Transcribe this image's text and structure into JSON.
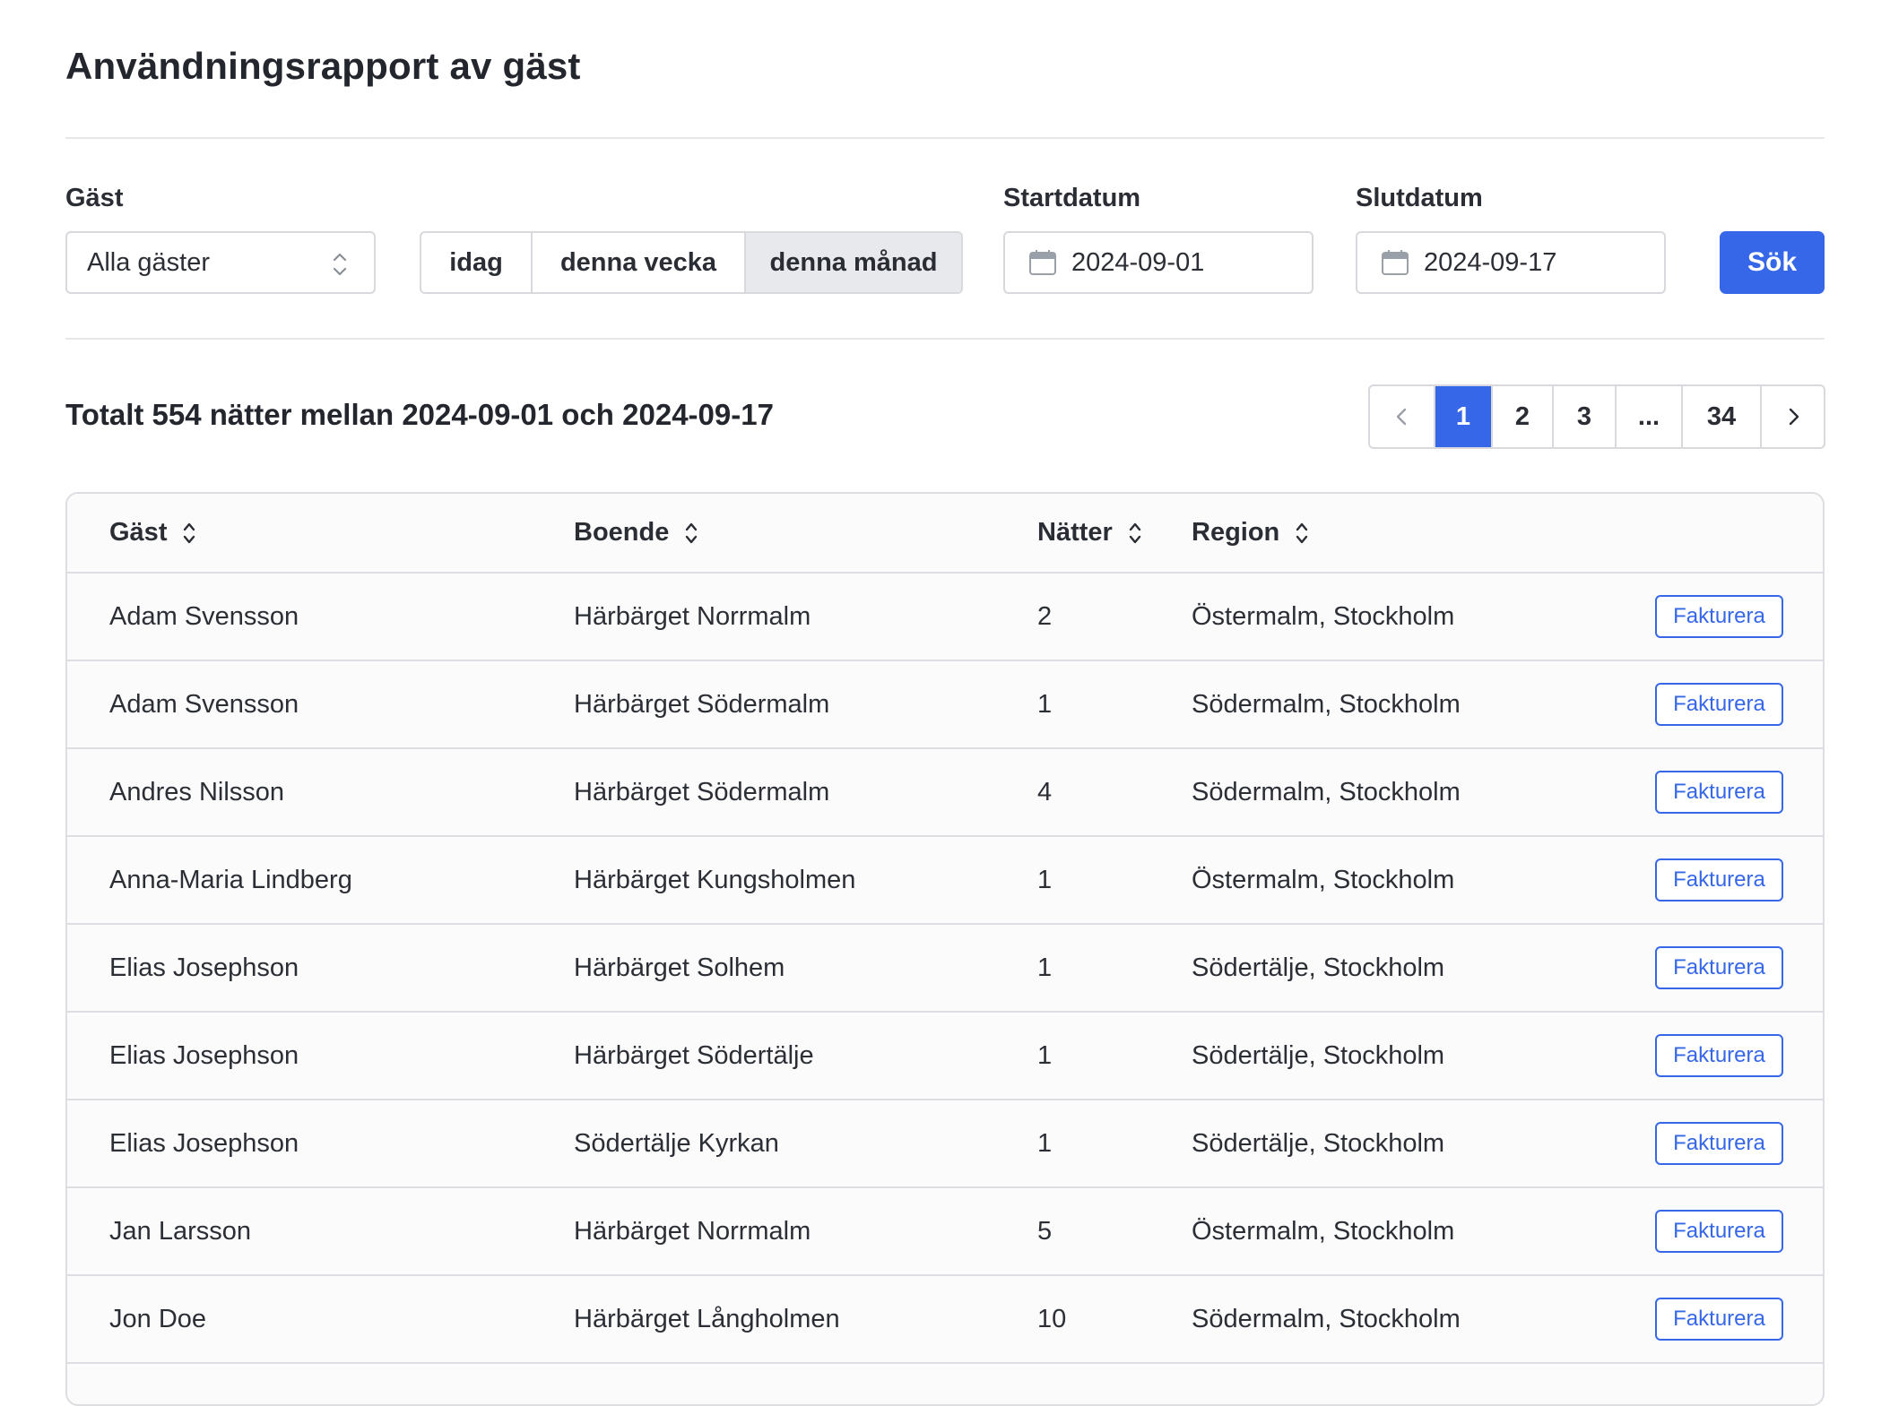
{
  "page": {
    "title": "Användningsrapport av gäst"
  },
  "filters": {
    "guest_label": "Gäst",
    "guest_value": "Alla gäster",
    "periods": [
      {
        "label": "idag",
        "active": false
      },
      {
        "label": "denna vecka",
        "active": false
      },
      {
        "label": "denna månad",
        "active": true
      }
    ],
    "start_label": "Startdatum",
    "start_value": "2024-09-01",
    "end_label": "Slutdatum",
    "end_value": "2024-09-17",
    "search_label": "Sök"
  },
  "summary": "Totalt 554 nätter mellan 2024-09-01 och 2024-09-17",
  "pagination": {
    "pages": [
      "1",
      "2",
      "3",
      "...",
      "34"
    ],
    "current": "1"
  },
  "table": {
    "columns": [
      "Gäst",
      "Boende",
      "Nätter",
      "Region"
    ],
    "action_label": "Fakturera",
    "rows": [
      {
        "guest": "Adam Svensson",
        "accommodation": "Härbärget Norrmalm",
        "nights": "2",
        "region": "Östermalm, Stockholm"
      },
      {
        "guest": "Adam Svensson",
        "accommodation": "Härbärget Södermalm",
        "nights": "1",
        "region": "Södermalm, Stockholm"
      },
      {
        "guest": "Andres Nilsson",
        "accommodation": "Härbärget Södermalm",
        "nights": "4",
        "region": "Södermalm, Stockholm"
      },
      {
        "guest": "Anna-Maria Lindberg",
        "accommodation": "Härbärget Kungsholmen",
        "nights": "1",
        "region": "Östermalm, Stockholm"
      },
      {
        "guest": "Elias Josephson",
        "accommodation": "Härbärget Solhem",
        "nights": "1",
        "region": "Södertälje, Stockholm"
      },
      {
        "guest": "Elias Josephson",
        "accommodation": "Härbärget Södertälje",
        "nights": "1",
        "region": "Södertälje, Stockholm"
      },
      {
        "guest": "Elias Josephson",
        "accommodation": "Södertälje Kyrkan",
        "nights": "1",
        "region": "Södertälje, Stockholm"
      },
      {
        "guest": "Jan Larsson",
        "accommodation": "Härbärget Norrmalm",
        "nights": "5",
        "region": "Östermalm, Stockholm"
      },
      {
        "guest": "Jon Doe",
        "accommodation": "Härbärget Långholmen",
        "nights": "10",
        "region": "Södermalm, Stockholm"
      }
    ]
  },
  "colors": {
    "accent": "#3567e8",
    "border": "#d7d9dd",
    "active_segment": "#e8e9ec"
  }
}
